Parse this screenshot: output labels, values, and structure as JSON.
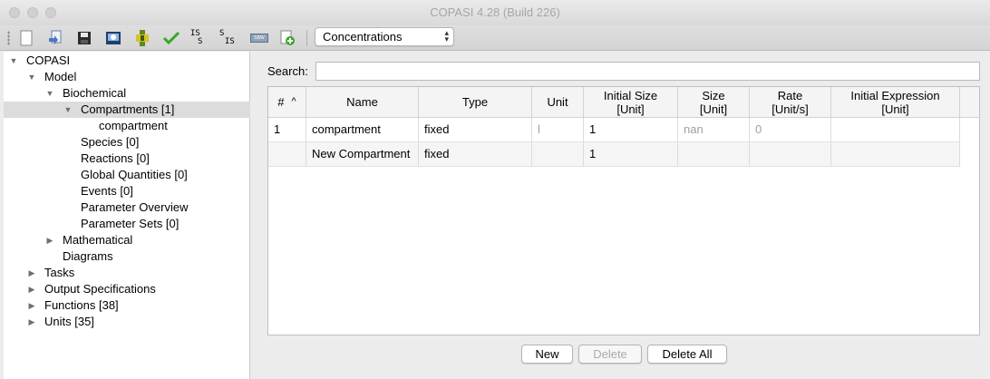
{
  "window": {
    "title": "COPASI 4.28 (Build 226)"
  },
  "toolbar": {
    "icons": [
      "new-file-icon",
      "open-file-icon",
      "save-icon",
      "save-as-image-icon",
      "plugin-icon",
      "check-icon",
      "import-sbml-icon",
      "export-sbml-icon",
      "sbw-icon",
      "add-icon"
    ],
    "import_label": "IS",
    "import_sub": "S",
    "export_label": "S",
    "export_sub": "IS",
    "sbw_label": "SBW",
    "concentration_select": "Concentrations"
  },
  "tree": {
    "root": "COPASI",
    "model": "Model",
    "biochemical": "Biochemical",
    "compartments": "Compartments [1]",
    "compartment_child": "compartment",
    "species": "Species [0]",
    "reactions": "Reactions [0]",
    "global_quantities": "Global Quantities [0]",
    "events": "Events [0]",
    "parameter_overview": "Parameter Overview",
    "parameter_sets": "Parameter Sets [0]",
    "mathematical": "Mathematical",
    "diagrams": "Diagrams",
    "tasks": "Tasks",
    "output_specifications": "Output Specifications",
    "functions": "Functions [38]",
    "units": "Units [35]"
  },
  "search": {
    "label": "Search:",
    "value": ""
  },
  "table": {
    "headers": {
      "num": "#",
      "sort_indicator": "^",
      "name": "Name",
      "type": "Type",
      "unit": "Unit",
      "initial_size_1": "Initial Size",
      "initial_size_2": "[Unit]",
      "size_1": "Size",
      "size_2": "[Unit]",
      "rate_1": "Rate",
      "rate_2": "[Unit/s]",
      "initial_expression_1": "Initial Expression",
      "initial_expression_2": "[Unit]"
    },
    "rows": [
      {
        "num": "1",
        "name": "compartment",
        "type": "fixed",
        "unit": "l",
        "initial_size": "1",
        "size": "nan",
        "rate": "0",
        "initial_expression": ""
      },
      {
        "num": "",
        "name": "New Compartment",
        "type": "fixed",
        "unit": "",
        "initial_size": "1",
        "size": "",
        "rate": "",
        "initial_expression": ""
      }
    ]
  },
  "buttons": {
    "new": "New",
    "delete": "Delete",
    "delete_all": "Delete All"
  },
  "colors": {
    "selection": "#dcdcdc",
    "check_green": "#3aa62b",
    "plugin_green": "#5d8a1a",
    "plugin_yellow": "#d8c32a"
  }
}
